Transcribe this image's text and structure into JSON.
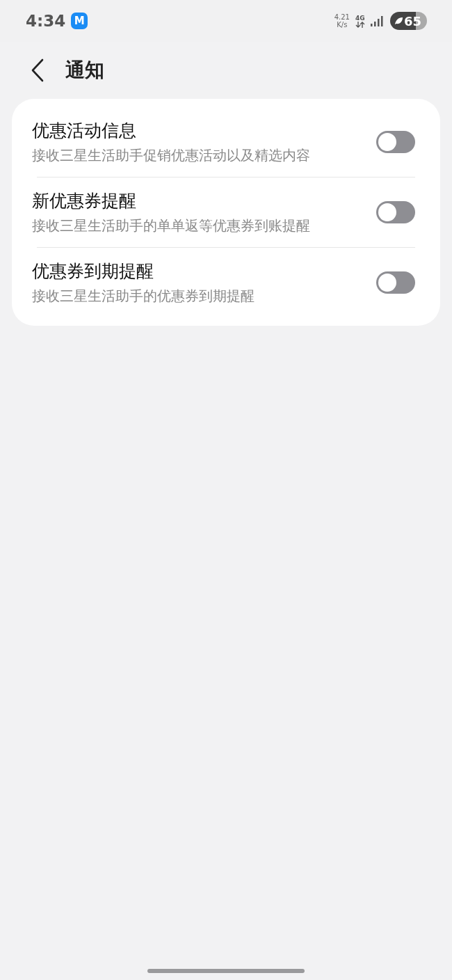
{
  "status_bar": {
    "time": "4:34",
    "app_badge": "M",
    "net_speed": "4.21",
    "net_unit": "K/s",
    "network": "4G",
    "battery": "65"
  },
  "header": {
    "title": "通知"
  },
  "settings": [
    {
      "title": "优惠活动信息",
      "description": "接收三星生活助手促销优惠活动以及精选内容",
      "on": false
    },
    {
      "title": "新优惠券提醒",
      "description": "接收三星生活助手的单单返等优惠券到账提醒",
      "on": false
    },
    {
      "title": "优惠券到期提醒",
      "description": "接收三星生活助手的优惠券到期提醒",
      "on": false
    }
  ]
}
